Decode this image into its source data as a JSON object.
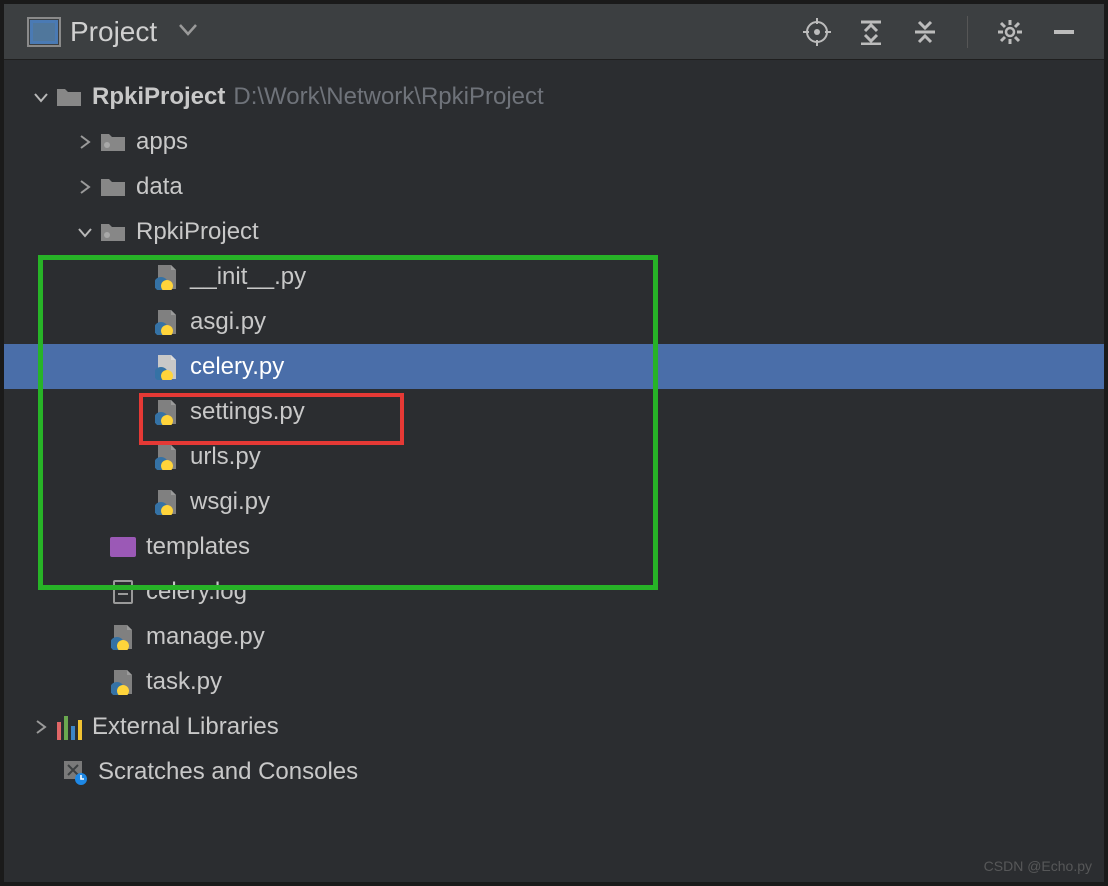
{
  "header": {
    "title": "Project"
  },
  "root": {
    "name": "RpkiProject",
    "path": "D:\\Work\\Network\\RpkiProject"
  },
  "tree": {
    "apps": "apps",
    "data": "data",
    "pkg": "RpkiProject",
    "init": "__init__.py",
    "asgi": "asgi.py",
    "celery": "celery.py",
    "settings": "settings.py",
    "urls": "urls.py",
    "wsgi": "wsgi.py",
    "templates": "templates",
    "celerylog": "celery.log",
    "manage": "manage.py",
    "task": "task.py",
    "extlibs": "External Libraries",
    "scratches": "Scratches and Consoles"
  },
  "watermark": "CSDN @Echo.py"
}
